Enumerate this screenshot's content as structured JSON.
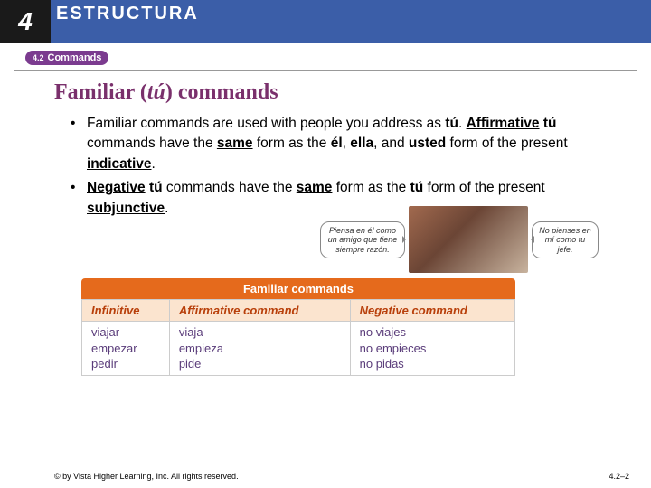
{
  "header": {
    "chapter": "4",
    "banner": "ESTRUCTURA"
  },
  "section": {
    "tab_number": "4.2",
    "tab_label": "Commands"
  },
  "slide_title": {
    "prefix": "Familiar (",
    "italic": "tú",
    "suffix": ") commands"
  },
  "bullets": [
    {
      "runs": [
        {
          "t": "Familiar commands are used with people you address as "
        },
        {
          "t": "tú",
          "style": "b"
        },
        {
          "t": ". "
        },
        {
          "t": "Affirmative",
          "style": "bu"
        },
        {
          "t": " "
        },
        {
          "t": "tú",
          "style": "b"
        },
        {
          "t": " commands have the "
        },
        {
          "t": "same",
          "style": "bu"
        },
        {
          "t": " form as the "
        },
        {
          "t": "él",
          "style": "b"
        },
        {
          "t": ", "
        },
        {
          "t": "ella",
          "style": "b"
        },
        {
          "t": ", and "
        },
        {
          "t": "usted",
          "style": "b"
        },
        {
          "t": " form of the present "
        },
        {
          "t": "indicative",
          "style": "bu"
        },
        {
          "t": "."
        }
      ]
    },
    {
      "runs": [
        {
          "t": "Negative",
          "style": "bu"
        },
        {
          "t": " "
        },
        {
          "t": "tú",
          "style": "b"
        },
        {
          "t": " commands have the "
        },
        {
          "t": "same",
          "style": "bu"
        },
        {
          "t": " form as the "
        },
        {
          "t": "tú",
          "style": "b"
        },
        {
          "t": " form of the present "
        },
        {
          "t": "subjunctive",
          "style": "bu"
        },
        {
          "t": "."
        }
      ]
    }
  ],
  "figure": {
    "bubble_left": "Piensa en él como un amigo que tiene siempre razón.",
    "bubble_right": "No pienses en mí como tu jefe."
  },
  "table": {
    "title": "Familiar commands",
    "headers": [
      "Infinitive",
      "Affirmative command",
      "Negative command"
    ],
    "rows": [
      [
        "viajar",
        "viaja",
        "no viajes"
      ],
      [
        "empezar",
        "empieza",
        "no empieces"
      ],
      [
        "pedir",
        "pide",
        "no pidas"
      ]
    ]
  },
  "footer": {
    "copyright": "© by Vista Higher Learning, Inc. All rights reserved.",
    "page": "4.2–2"
  }
}
